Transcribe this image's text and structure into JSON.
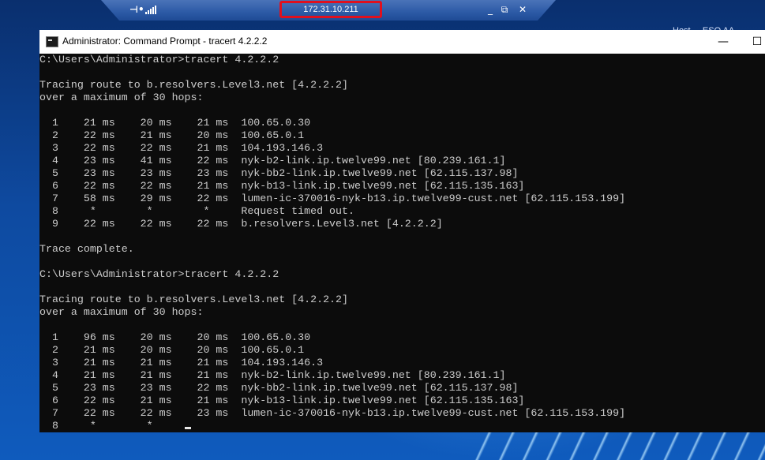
{
  "rdp_bar": {
    "pin_icon": "pin-icon",
    "signal_icon": "signal-strength-icon",
    "host_ip": "172.31.10.211",
    "minimize_icon": "minimize-icon",
    "restore_icon": "restore-icon",
    "close_icon": "close-icon"
  },
  "remote_peek_text": "Host ... ESO AA",
  "window": {
    "title": "Administrator: Command Prompt - tracert  4.2.2.2",
    "minimize_glyph": "—",
    "maximize_glyph": "☐"
  },
  "console": {
    "lines": [
      "C:\\Users\\Administrator>tracert 4.2.2.2",
      "",
      "Tracing route to b.resolvers.Level3.net [4.2.2.2]",
      "over a maximum of 30 hops:",
      "",
      "  1    21 ms    20 ms    21 ms  100.65.0.30",
      "  2    22 ms    21 ms    20 ms  100.65.0.1",
      "  3    22 ms    22 ms    21 ms  104.193.146.3",
      "  4    23 ms    41 ms    22 ms  nyk-b2-link.ip.twelve99.net [80.239.161.1]",
      "  5    23 ms    23 ms    23 ms  nyk-bb2-link.ip.twelve99.net [62.115.137.98]",
      "  6    22 ms    22 ms    21 ms  nyk-b13-link.ip.twelve99.net [62.115.135.163]",
      "  7    58 ms    29 ms    22 ms  lumen-ic-370016-nyk-b13.ip.twelve99-cust.net [62.115.153.199]",
      "  8     *        *        *     Request timed out.",
      "  9    22 ms    22 ms    22 ms  b.resolvers.Level3.net [4.2.2.2]",
      "",
      "Trace complete.",
      "",
      "C:\\Users\\Administrator>tracert 4.2.2.2",
      "",
      "Tracing route to b.resolvers.Level3.net [4.2.2.2]",
      "over a maximum of 30 hops:",
      "",
      "  1    96 ms    20 ms    20 ms  100.65.0.30",
      "  2    21 ms    20 ms    20 ms  100.65.0.1",
      "  3    21 ms    21 ms    21 ms  104.193.146.3",
      "  4    21 ms    21 ms    21 ms  nyk-b2-link.ip.twelve99.net [80.239.161.1]",
      "  5    23 ms    23 ms    22 ms  nyk-bb2-link.ip.twelve99.net [62.115.137.98]",
      "  6    22 ms    21 ms    21 ms  nyk-b13-link.ip.twelve99.net [62.115.135.163]",
      "  7    22 ms    22 ms    23 ms  lumen-ic-370016-nyk-b13.ip.twelve99-cust.net [62.115.153.199]"
    ],
    "last_line": "  8     *        *     "
  }
}
